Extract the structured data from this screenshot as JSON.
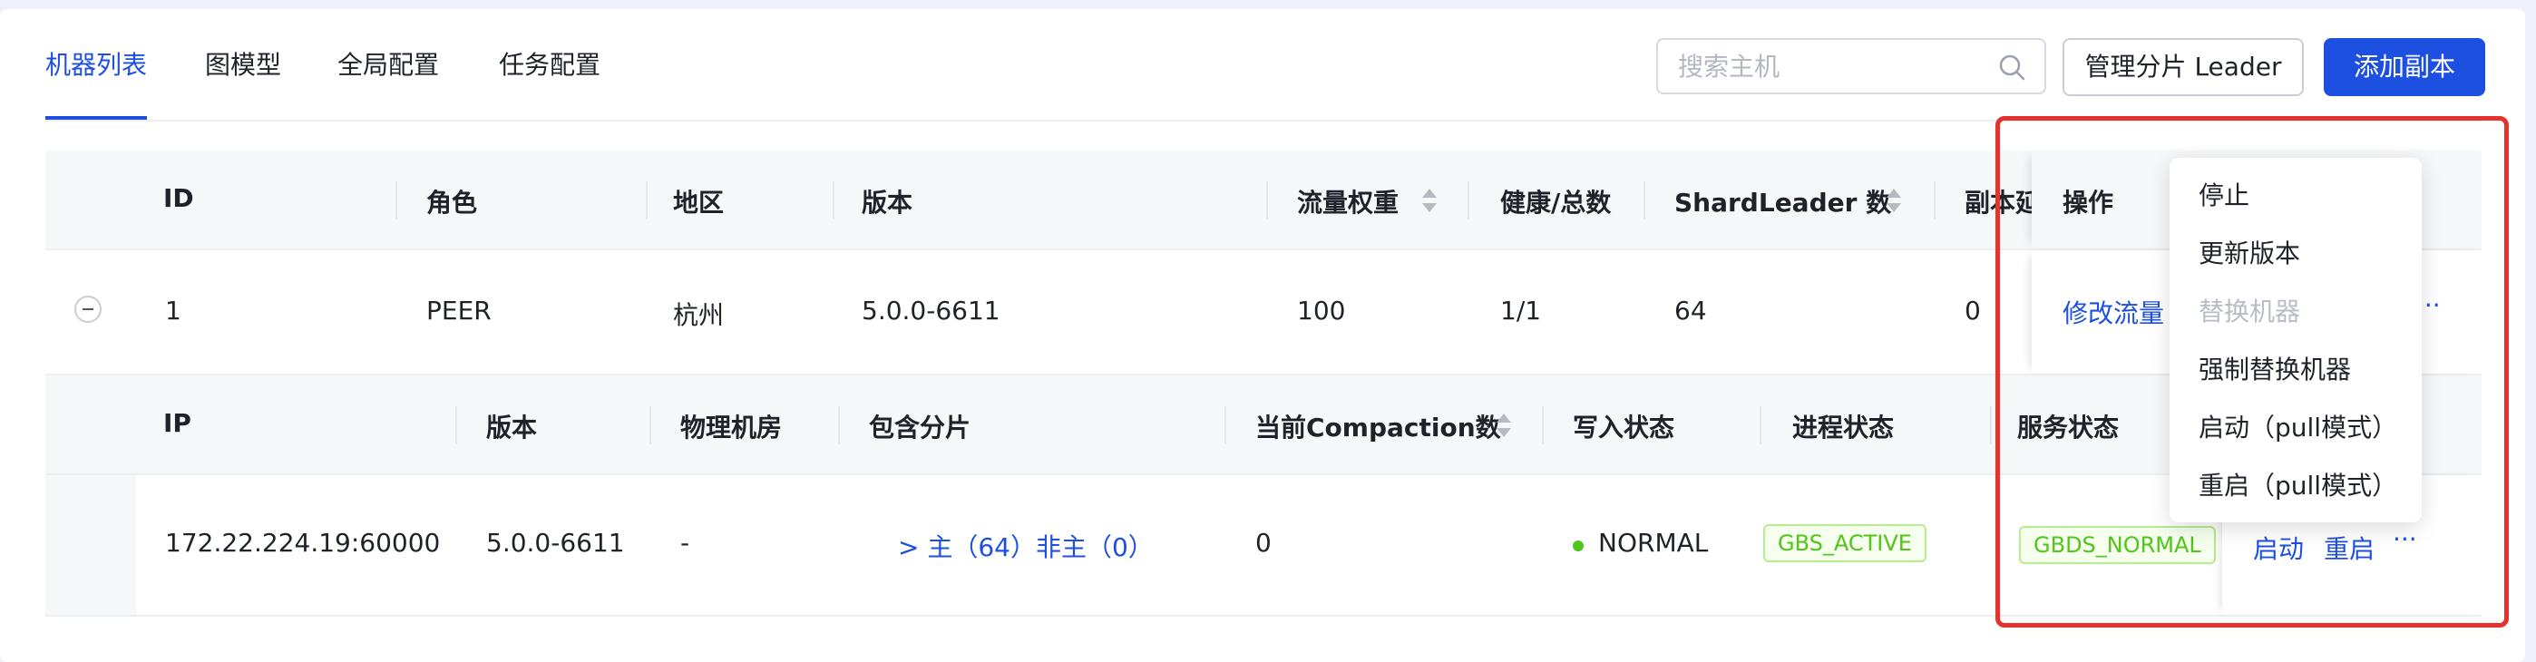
{
  "tabs": [
    "机器列表",
    "图模型",
    "全局配置",
    "任务配置"
  ],
  "toolbar": {
    "search_placeholder": "搜索主机",
    "manage_leader_label": "管理分片 Leader",
    "add_replica_label": "添加副本"
  },
  "outer_table": {
    "headers": {
      "id": "ID",
      "role": "角色",
      "region": "地区",
      "version": "版本",
      "traffic_weight": "流量权重",
      "health": "健康/总数",
      "shard_leader": "ShardLeader 数",
      "replica_delay": "副本延",
      "ops": "操作"
    },
    "row": {
      "id": "1",
      "role": "PEER",
      "region": "杭州",
      "version": "5.0.0-6611",
      "traffic_weight": "100",
      "health": "1/1",
      "shard_leader": "64",
      "replica_delay": "0",
      "op_link": "修改流量",
      "more": "···"
    }
  },
  "inner_table": {
    "headers": {
      "ip": "IP",
      "version": "版本",
      "room": "物理机房",
      "shards": "包含分片",
      "compaction": "当前Compaction数",
      "write_status": "写入状态",
      "process_status": "进程状态",
      "service_status": "服务状态"
    },
    "row": {
      "ip": "172.22.224.19:60000",
      "version": "5.0.0-6611",
      "room": "-",
      "shards": "> 主（64）非主（0）",
      "compaction": "0",
      "write_status": "NORMAL",
      "process_status": "GBS_ACTIVE",
      "service_status": "GBDS_NORMAL",
      "op_start": "启动",
      "op_restart": "重启",
      "more": "···"
    }
  },
  "dropdown": {
    "items": [
      {
        "label": "停止",
        "disabled": false
      },
      {
        "label": "更新版本",
        "disabled": false
      },
      {
        "label": "替换机器",
        "disabled": true
      },
      {
        "label": "强制替换机器",
        "disabled": false
      },
      {
        "label": "启动（pull模式）",
        "disabled": false
      },
      {
        "label": "重启（pull模式）",
        "disabled": false
      }
    ]
  },
  "colors": {
    "primary": "#1d4fe0",
    "success": "#52c41a",
    "highlight": "#e5322d"
  }
}
